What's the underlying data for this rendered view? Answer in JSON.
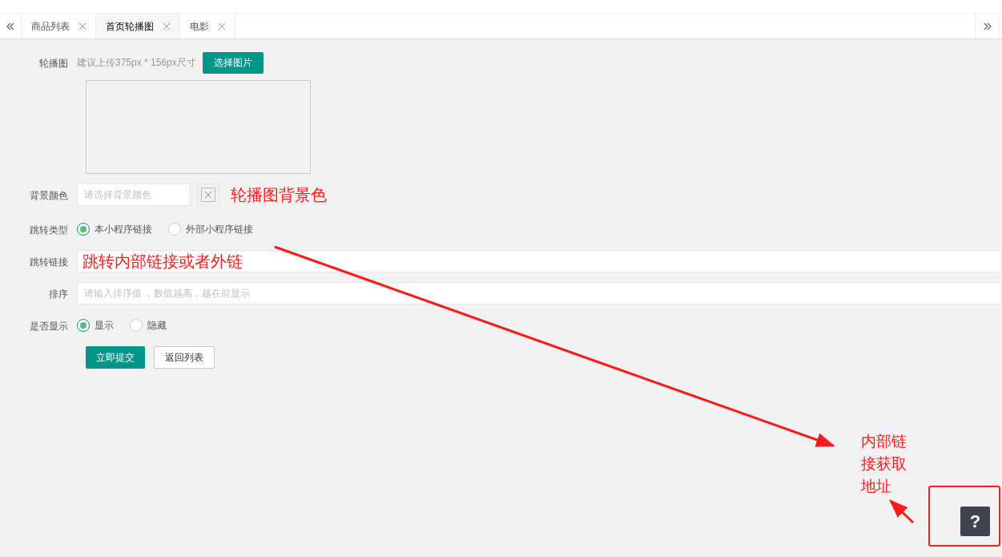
{
  "tabs": [
    {
      "label": "商品列表",
      "selected": false
    },
    {
      "label": "首页轮播图",
      "selected": true
    },
    {
      "label": "电影",
      "selected": false
    }
  ],
  "form": {
    "image": {
      "label": "轮播图",
      "hint": "建议上传375px * 156px尺寸",
      "button": "选择图片"
    },
    "background_color": {
      "label": "背景颜色",
      "placeholder": "请选择背景颜色"
    },
    "jump_type": {
      "label": "跳转类型",
      "options": [
        {
          "label": "本小程序链接",
          "selected": true
        },
        {
          "label": "外部小程序链接",
          "selected": false
        }
      ]
    },
    "jump_link": {
      "label": "跳转链接",
      "value": "跳转内部链接或者外链"
    },
    "sort": {
      "label": "排序",
      "placeholder": "请输入排序值 ，数值越高，越在前显示"
    },
    "visible": {
      "label": "是否显示",
      "options": [
        {
          "label": "显示",
          "selected": true
        },
        {
          "label": "隐藏",
          "selected": false
        }
      ]
    },
    "buttons": [
      {
        "label": "立即提交",
        "kind": "primary"
      },
      {
        "label": "返回列表",
        "kind": "default"
      }
    ]
  },
  "annotations": {
    "color_note": "轮播图背景色",
    "link_note": "内部链接获取地址"
  },
  "help_button": {
    "label": "?"
  }
}
